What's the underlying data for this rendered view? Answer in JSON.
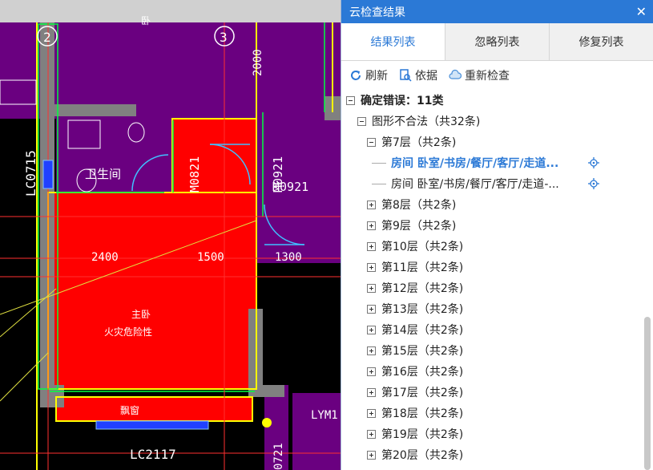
{
  "cad": {
    "axis_labels": [
      "2",
      "3"
    ],
    "dims": [
      "2000",
      "2400",
      "1500",
      "1300"
    ],
    "window_tags": [
      "LC0715",
      "LC2117",
      "LYM1"
    ],
    "door_tags": [
      "M0821",
      "M0921",
      "M0921"
    ],
    "room_bath": "卫生间",
    "room_master": "主卧",
    "room_master_sub": "火灾危险性",
    "room_balcony": "飘窗",
    "tag_0721": "0721",
    "tag_top": "卧"
  },
  "panel": {
    "title": "云检查结果",
    "close_glyph": "✕",
    "tabs": [
      "结果列表",
      "忽略列表",
      "修复列表"
    ],
    "toolbar": {
      "refresh": "刷新",
      "basis": "依据",
      "recheck": "重新检查"
    },
    "tree": {
      "root": "确定错误：11类",
      "group": "图形不合法（共32条)",
      "floor7": "第7层（共2条)",
      "item1": "房间 卧室/书房/餐厅/客厅/走道...",
      "item2": "房间 卧室/书房/餐厅/客厅/走道-...",
      "floors": [
        "第8层（共2条)",
        "第9层（共2条)",
        "第10层（共2条)",
        "第11层（共2条)",
        "第12层（共2条)",
        "第13层（共2条)",
        "第14层（共2条)",
        "第15层（共2条)",
        "第16层（共2条)",
        "第17层（共2条)",
        "第18层（共2条)",
        "第19层（共2条)",
        "第20层（共2条)"
      ]
    }
  },
  "colors": {
    "accent": "#2b79d6",
    "wall_purple": "#6a0080",
    "room_red": "#ff0000"
  }
}
